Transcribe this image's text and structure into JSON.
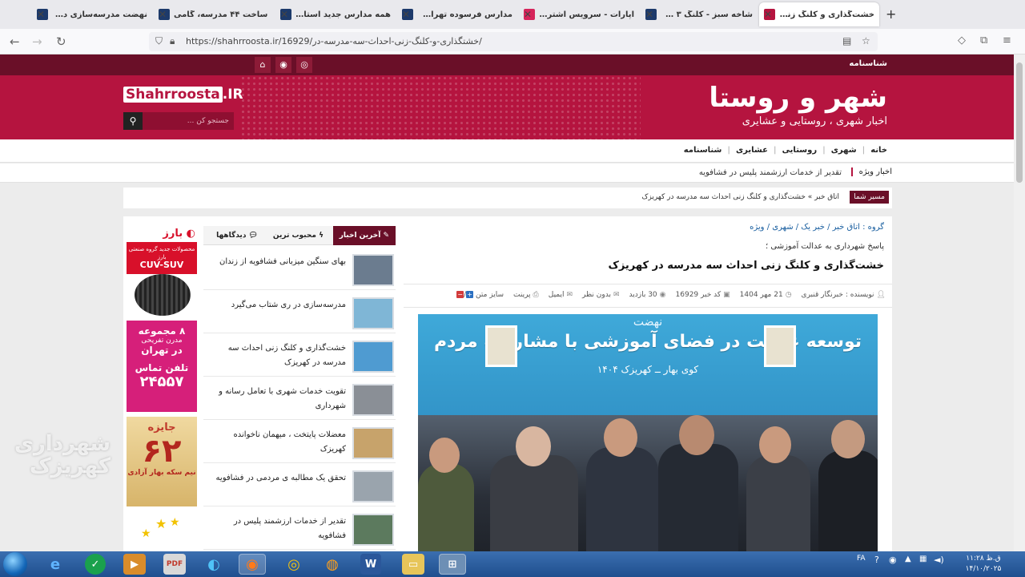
{
  "browser": {
    "tabs": [
      {
        "title": "نهضت مدرسه‌سازی در مشه",
        "color": "#1d3a6b",
        "active": false
      },
      {
        "title": "ساخت ۴۴ مدرسه، گامی",
        "color": "#1d3a6b",
        "active": false
      },
      {
        "title": "همه مدارس جدید استان تهران",
        "color": "#1d3a6b",
        "active": false
      },
      {
        "title": "مدارس فرسوده تهران از چرا",
        "color": "#1d3a6b",
        "active": false
      },
      {
        "title": "آپارات - سرویس اشتراک ویدئو",
        "color": "#d6245b",
        "active": false
      },
      {
        "title": "شاخه سبز - کلنگ ۳ مدرسه در",
        "color": "#1d3a6b",
        "active": false
      },
      {
        "title": "خشت‌گذاری و کلنگ زنی احد",
        "color": "#b5143f",
        "active": true
      }
    ],
    "url": "https://shahrroosta.ir/16929/خشتگذاری-و-کلنگ-زنی-احداث-سه-مدرسه-در/"
  },
  "site": {
    "top_link": "شناسنامه",
    "logo_title": "شهر و روستا",
    "logo_sub": "اخبار شهری ، روستایی و عشایری",
    "brand_box": "Shahrroosta",
    "brand_tld": ".IR",
    "search_placeholder": "جستجو کن ...",
    "nav": [
      "خانه",
      "شهری",
      "روستایی",
      "عشایری",
      "شناسنامه"
    ],
    "special_label": "اخبار ویژه",
    "special_text": "تقدیر از خدمات ارزشمند پلیس در فشافویه",
    "breadcrumb_label": "مسیر شما",
    "breadcrumb_text": "اتاق خبر » خشت‌گذاری و کلنگ زنی احداث سه مدرسه در کهریزک"
  },
  "article": {
    "groups": "گروه : اتاق خبر / خبر یک / شهری / ویژه",
    "lead": "پاسخ شهرداری به عدالت آموزشی ؛",
    "headline": "خشت‌گذاری و کلنگ زنی احداث سه مدرسه در کهریزک",
    "meta": {
      "author": "نویسنده : خبرنگار قنبری",
      "date": "21 مهر 1404",
      "code": "کد خبر 16929",
      "views": "30 بازدید",
      "comments": "بدون نظر",
      "email": "ایمیل",
      "print": "پرینت",
      "font_size": "سایز متن"
    },
    "photo": {
      "banner_small": "نهضت",
      "banner_title": "توسعه عدالت در فضای آموزشی با مشارکت مردم",
      "banner_line": "کوی بهار ــ کهریزک ۱۴۰۴"
    }
  },
  "sidebar": {
    "tabs": [
      "آخرین اخبار",
      "محبوب ترین",
      "دیدگاهها"
    ],
    "news": [
      {
        "title": "بهای سنگین میزبانی فشافویه از زندان",
        "thumb": "#6b7c8f"
      },
      {
        "title": "مدرسه‌سازی در ری شتاب می‌گیرد",
        "thumb": "#7fb6d6"
      },
      {
        "title": "خشت‌گذاری و کلنگ زنی احداث سه مدرسه در کهریزک",
        "thumb": "#4f9bd1"
      },
      {
        "title": "تقویت خدمات شهری با تعامل رسانه و شهرداری",
        "thumb": "#8a8f96"
      },
      {
        "title": "معضلات پایتخت ، میهمان ناخوانده کهریزک",
        "thumb": "#c7a36b"
      },
      {
        "title": "تحقق یک مطالبه ی مردمی در فشافویه",
        "thumb": "#9aa4ad"
      },
      {
        "title": "تقدیر از خدمات ارزشمند پلیس در فشافویه",
        "thumb": "#5c7a5e"
      }
    ]
  },
  "ads": {
    "ad1_brand": "بارز",
    "ad1_text": "محصولات جدید گروه صنعتی بارز",
    "ad1_model": "CUV-SUV",
    "ad2_line1": "۸ مجموعه",
    "ad2_line2": "مدرن تفریحی",
    "ad2_line3": "در تهران",
    "ad2_phone_label": "تلفن تماس",
    "ad2_phone": "۲۴۵۵۷",
    "ad3_title": "جایزه",
    "ad3_number": "۶۲",
    "ad3_sub": "نیم سکه بهار آزادی"
  },
  "watermark": {
    "line1": "شهرداری",
    "line2": "کهریزک"
  },
  "taskbar": {
    "lang": "FA",
    "time": "ق.ظ ۱۱:۲۸",
    "date": "۱۴/۱۰/۲۰۲۵"
  }
}
